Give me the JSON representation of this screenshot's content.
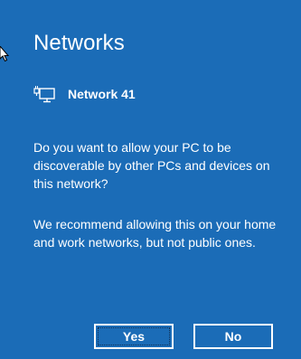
{
  "panel": {
    "title": "Networks",
    "background_color": "#1b6cb7"
  },
  "network": {
    "icon": "ethernet-icon",
    "name": "Network 41"
  },
  "message": {
    "question": "Do you want to allow your PC to be discoverable by other PCs and devices on this network?",
    "recommendation": "We recommend allowing this on your home and work networks, but not public ones."
  },
  "buttons": {
    "yes_label": "Yes",
    "no_label": "No"
  }
}
